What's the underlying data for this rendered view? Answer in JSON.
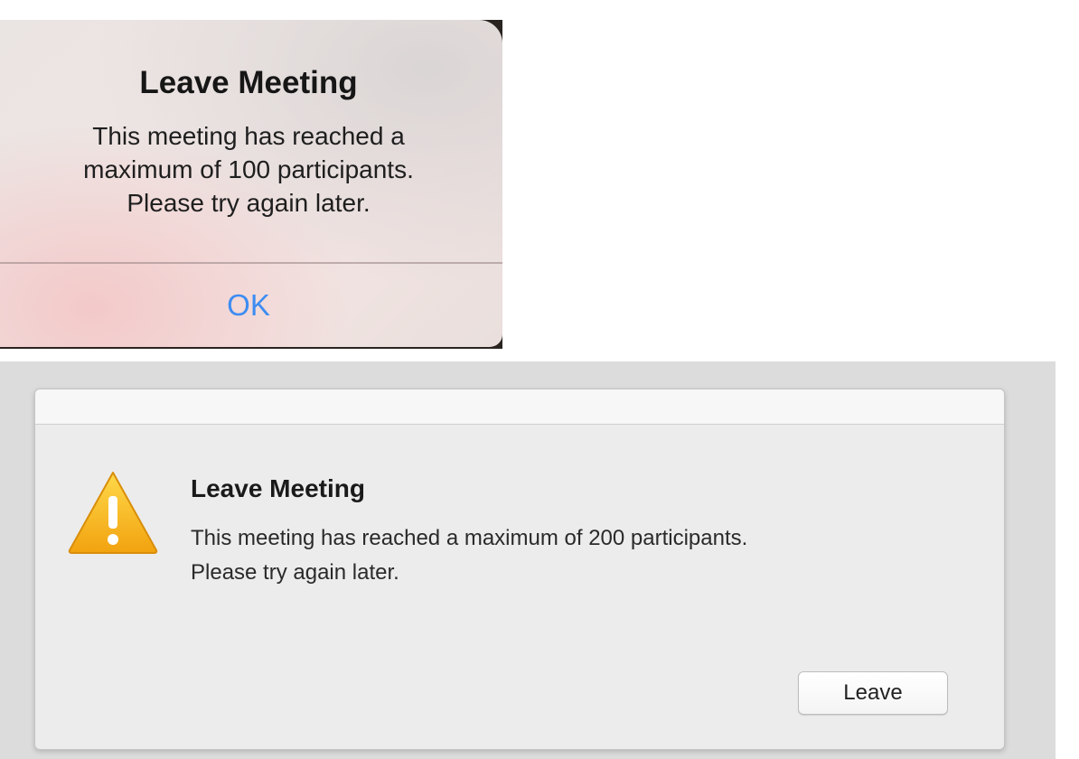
{
  "ios_alert": {
    "title": "Leave Meeting",
    "message_lines": [
      "This meeting has reached a",
      "maximum of 100 participants.",
      "Please try again later."
    ],
    "ok_label": "OK"
  },
  "mac_alert": {
    "icon": "warning-icon",
    "title": "Leave Meeting",
    "message_lines": [
      "This meeting has reached a maximum of 200 participants.",
      "Please try again later."
    ],
    "leave_label": "Leave"
  },
  "colors": {
    "ios_button": "#3d8cf2",
    "warning_yellow": "#f6b51e"
  }
}
